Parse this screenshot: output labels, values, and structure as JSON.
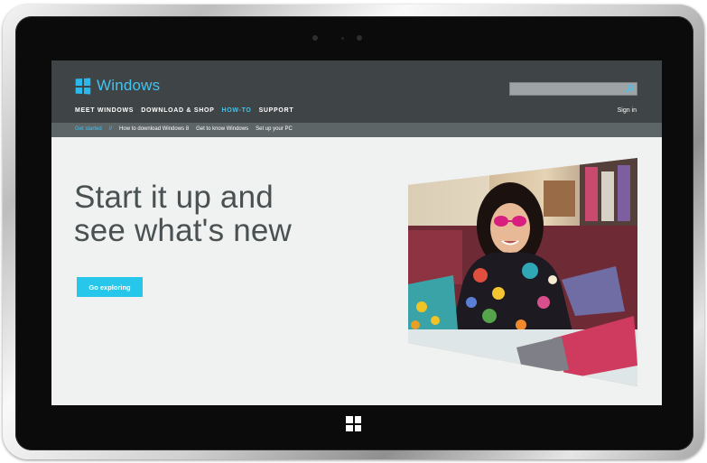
{
  "screen": {
    "brand": {
      "logo_icon": "windows-logo-icon",
      "name": "Windows"
    },
    "search": {
      "placeholder": "",
      "icon": "search-icon"
    },
    "top_nav": [
      {
        "label": "MEET WINDOWS",
        "active": false
      },
      {
        "label": "DOWNLOAD & SHOP",
        "active": false
      },
      {
        "label": "HOW-TO",
        "active": true
      },
      {
        "label": "SUPPORT",
        "active": false
      }
    ],
    "sign_in": "Sign in",
    "sub_nav": {
      "active": "Get started",
      "separator": "//",
      "items": [
        "How to download Windows 8",
        "Get to know Windows",
        "Set up your PC"
      ]
    },
    "hero": {
      "title_line1": "Start it up and",
      "title_line2": "see what's new",
      "cta": "Go exploring"
    },
    "photo_description_icon": "woman-with-laptop-photo"
  },
  "device": {
    "home_button_icon": "windows-start-icon"
  },
  "colors": {
    "accent": "#26c7ea",
    "header_bg": "#3f4546",
    "subnav_bg": "#5d6566",
    "page_bg": "#f0f1f1"
  }
}
